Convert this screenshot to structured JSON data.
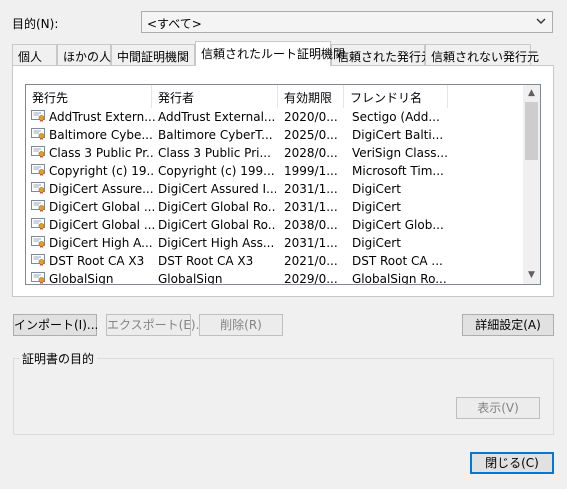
{
  "purpose": {
    "label": "目的(N):",
    "value": "<すべて>"
  },
  "tabs": [
    {
      "label": "個人"
    },
    {
      "label": "ほかの人"
    },
    {
      "label": "中間証明機関"
    },
    {
      "label": "信頼されたルート証明機関"
    },
    {
      "label": "信頼された発行元"
    },
    {
      "label": "信頼されない発行元"
    }
  ],
  "active_tab_index": 3,
  "list": {
    "columns": [
      "発行先",
      "発行者",
      "有効期限",
      "フレンドリ名"
    ],
    "rows": [
      [
        "AddTrust Extern...",
        "AddTrust External...",
        "2020/0...",
        "Sectigo (Add..."
      ],
      [
        "Baltimore Cybe...",
        "Baltimore CyberT...",
        "2025/0...",
        "DigiCert Balti..."
      ],
      [
        "Class 3 Public Pr...",
        "Class 3 Public Pri...",
        "2028/0...",
        "VeriSign Class..."
      ],
      [
        "Copyright (c) 19...",
        "Copyright (c) 199...",
        "1999/1...",
        "Microsoft Tim..."
      ],
      [
        "DigiCert Assure...",
        "DigiCert Assured I...",
        "2031/1...",
        "DigiCert"
      ],
      [
        "DigiCert Global ...",
        "DigiCert Global Ro...",
        "2031/1...",
        "DigiCert"
      ],
      [
        "DigiCert Global ...",
        "DigiCert Global Ro...",
        "2038/0...",
        "DigiCert Glob..."
      ],
      [
        "DigiCert High A...",
        "DigiCert High Ass...",
        "2031/1...",
        "DigiCert"
      ],
      [
        "DST Root CA X3",
        "DST Root CA X3",
        "2021/0...",
        "DST Root CA ..."
      ],
      [
        "GlobalSign",
        "GlobalSign",
        "2029/0...",
        "GlobalSign Ro..."
      ]
    ]
  },
  "buttons": {
    "import": "インポート(I)...",
    "export": "エクスポート(E)...",
    "delete": "削除(R)",
    "advanced": "詳細設定(A)",
    "view": "表示(V)",
    "close": "閉じる(C)"
  },
  "group": {
    "label": "証明書の目的"
  },
  "icons": {
    "row_icon": "certificate-icon",
    "dropdown": "chevron-down-icon"
  }
}
